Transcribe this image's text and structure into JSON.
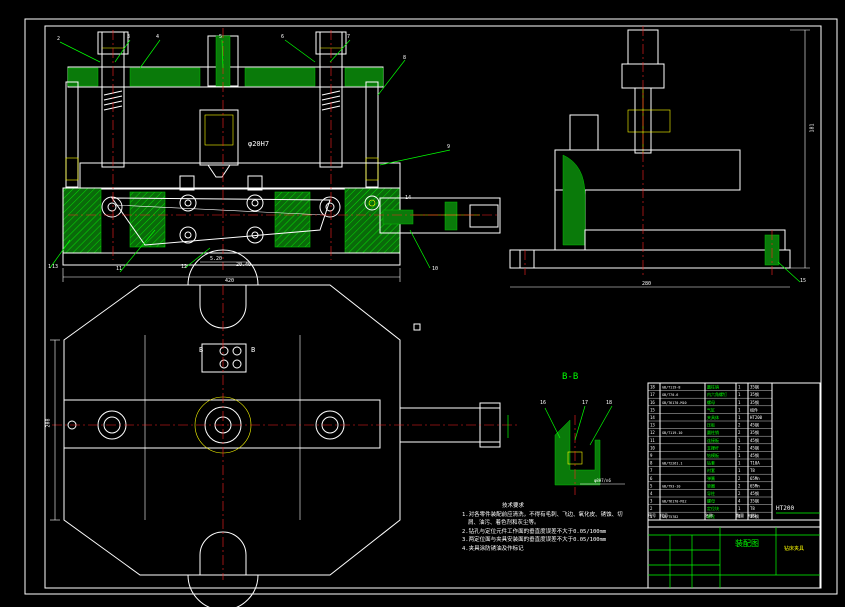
{
  "drawing": {
    "section_label": "B-B",
    "view_marker": "B",
    "dia_dim": "φ20H7",
    "dims": {
      "front_width": "420",
      "side_width": "280",
      "side_height": "181",
      "plan_height": "208",
      "mid_dim_a": "5.20",
      "mid_dim_b": "20.40",
      "section_dim": "φ8H7/n6"
    },
    "leaders": [
      "1",
      "2",
      "3",
      "4",
      "5",
      "6",
      "7",
      "8",
      "9",
      "10",
      "11",
      "12",
      "13",
      "14",
      "15",
      "16",
      "17",
      "18"
    ],
    "section_leaders": [
      "16",
      "17",
      "18"
    ]
  },
  "notes": {
    "title": "技术要求",
    "lines": [
      "1.对各零件装配前应清洗，不得有毛刺、飞边、氧化皮、锈蚀、切",
      "屑、油污、着色剂和灰尘等。",
      "2.钻孔与定位元件工作面的垂直度误差不大于0.05/100mm",
      "3.两定位面与夹具安装面的垂直度误差不大于0.05/100mm",
      "4.夹具涂防锈油及作标记"
    ]
  },
  "bom": {
    "rows": [
      [
        "18",
        "GB/T119-8",
        "圆柱销",
        "1",
        "35钢"
      ],
      [
        "17",
        "GB/T70-6",
        "内六角螺钉",
        "1",
        "35钢"
      ],
      [
        "16",
        "GB/T6170-M10",
        "螺母",
        "1",
        "35钢"
      ],
      [
        "15",
        "",
        "气缸",
        "1",
        "组件"
      ],
      [
        "14",
        "",
        "夹具体",
        "1",
        "HT200"
      ],
      [
        "13",
        "",
        "压板",
        "2",
        "45钢"
      ],
      [
        "12",
        "GB/T119-10",
        "圆柱销",
        "2",
        "35钢"
      ],
      [
        "11",
        "",
        "连接板",
        "1",
        "45钢"
      ],
      [
        "10",
        "",
        "支撑杆",
        "2",
        "45钢"
      ],
      [
        "9",
        "",
        "钻模板",
        "1",
        "45钢"
      ],
      [
        "8",
        "GB/T2261.1",
        "钻套",
        "1",
        "T10A"
      ],
      [
        "7",
        "",
        "衬套",
        "1",
        "T8"
      ],
      [
        "6",
        "",
        "弹簧",
        "2",
        "65Mn"
      ],
      [
        "5",
        "GB/T93-10",
        "垫圈",
        "2",
        "65Mn"
      ],
      [
        "4",
        "",
        "导柱",
        "2",
        "45钢"
      ],
      [
        "3",
        "GB/T6170-M12",
        "螺母",
        "4",
        "35钢"
      ],
      [
        "2",
        "",
        "定位块",
        "1",
        "T8"
      ],
      [
        "1",
        "GB/T5782",
        "螺栓",
        "4",
        "35钢"
      ]
    ],
    "header": [
      "序号",
      "代号",
      "名称",
      "数量",
      "材料"
    ],
    "last_material": "HT200",
    "title_block": {
      "drawing_name": "装配图",
      "part_name": "钻床夹具"
    }
  }
}
